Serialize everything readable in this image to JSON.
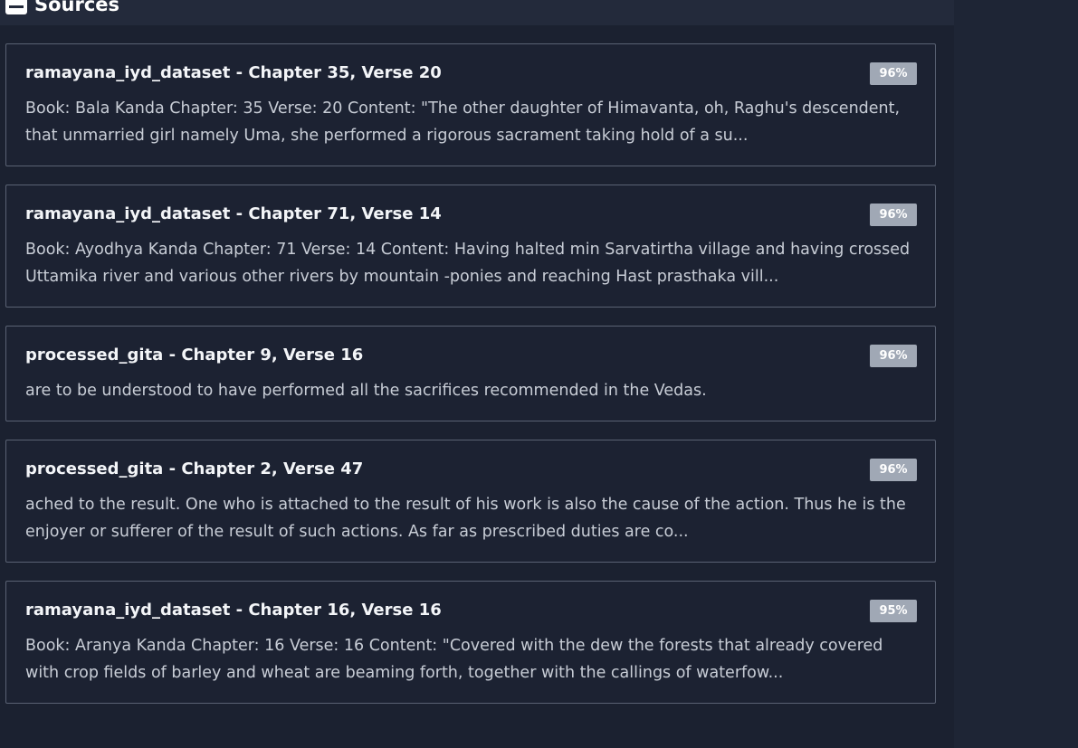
{
  "header": {
    "title": "Sources",
    "icon": "book-icon"
  },
  "sources": [
    {
      "title": "ramayana_iyd_dataset - Chapter 35, Verse 20",
      "score": "96%",
      "line1": "Book: Bala Kanda Chapter: 35 Verse: 20 Content: \"The other daughter of Himavanta, oh, Raghu's descendent,",
      "line2": "that unmarried girl namely Uma, she performed a rigorous sacrament taking hold of a su..."
    },
    {
      "title": "ramayana_iyd_dataset - Chapter 71, Verse 14",
      "score": "96%",
      "line1": "Book: Ayodhya Kanda Chapter: 71 Verse: 14 Content: Having halted min Sarvatirtha village and having crossed",
      "line2": "Uttamika river and various other rivers by mountain -ponies and reaching Hast prasthaka vill..."
    },
    {
      "title": "processed_gita - Chapter 9, Verse 16",
      "score": "96%",
      "line1": "are to be understood to have performed all the sacrifices recommended in the Vedas.",
      "line2": ""
    },
    {
      "title": "processed_gita - Chapter 2, Verse 47",
      "score": "96%",
      "line1": "ached to the result. One who is attached to the result of his work is also the cause of the action. Thus he is the",
      "line2": "enjoyer or sufferer of the result of such actions. As far as prescribed duties are co..."
    },
    {
      "title": "ramayana_iyd_dataset - Chapter 16, Verse 16",
      "score": "95%",
      "line1": "Book: Aranya Kanda Chapter: 16 Verse: 16 Content: \"Covered with the dew the forests that already covered",
      "line2": "with crop fields of barley and wheat are beaming forth, together with the callings of waterfow..."
    }
  ]
}
